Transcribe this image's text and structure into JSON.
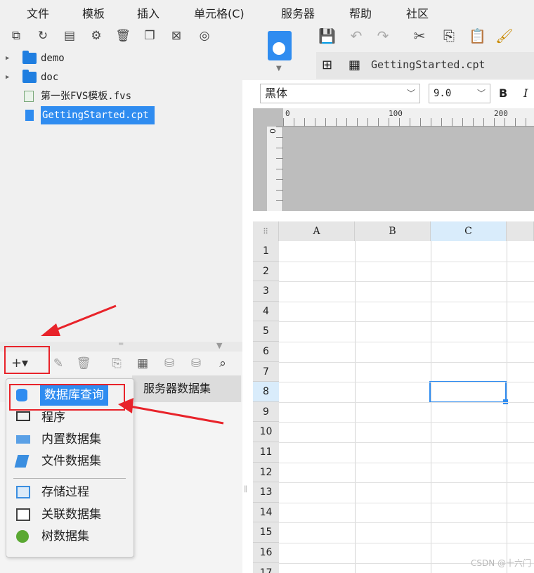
{
  "menu": [
    "文件",
    "模板",
    "插入",
    "单元格(C)",
    "服务器",
    "帮助",
    "社区"
  ],
  "tree": [
    {
      "label": "demo",
      "type": "folder"
    },
    {
      "label": "doc",
      "type": "folder"
    },
    {
      "label": "第一张FVS模板.fvs",
      "type": "fvs"
    },
    {
      "label": "GettingStarted.cpt",
      "type": "cpt",
      "selected": true
    }
  ],
  "datasource": {
    "add_button": "+▾",
    "server_dataset_label": "服务器数据集"
  },
  "popup": {
    "items": [
      {
        "label": "数据库查询",
        "icon": "database-icon",
        "highlighted": true
      },
      {
        "label": "程序",
        "icon": "monitor-icon"
      },
      {
        "label": "内置数据集",
        "icon": "builtin-dataset-icon"
      },
      {
        "label": "文件数据集",
        "icon": "file-dataset-icon"
      },
      {
        "label": "存储过程",
        "icon": "stored-procedure-icon"
      },
      {
        "label": "关联数据集",
        "icon": "relation-dataset-icon"
      },
      {
        "label": "树数据集",
        "icon": "tree-dataset-icon"
      }
    ]
  },
  "editor": {
    "tab_name": "GettingStarted.cpt",
    "font_name": "黑体",
    "font_size": "9.0",
    "bold": "B",
    "italic": "I",
    "ruler_labels": [
      "0",
      "100",
      "200"
    ],
    "columns": [
      "A",
      "B",
      "C"
    ],
    "rows": [
      "1",
      "2",
      "3",
      "4",
      "5",
      "6",
      "7",
      "8",
      "9",
      "10",
      "11",
      "12",
      "13",
      "14",
      "15",
      "16",
      "17"
    ],
    "selected_cell": "C8"
  },
  "watermark": "CSDN @十六门",
  "colors": {
    "accent": "#2f8cf0",
    "annotation": "#e8232a"
  }
}
